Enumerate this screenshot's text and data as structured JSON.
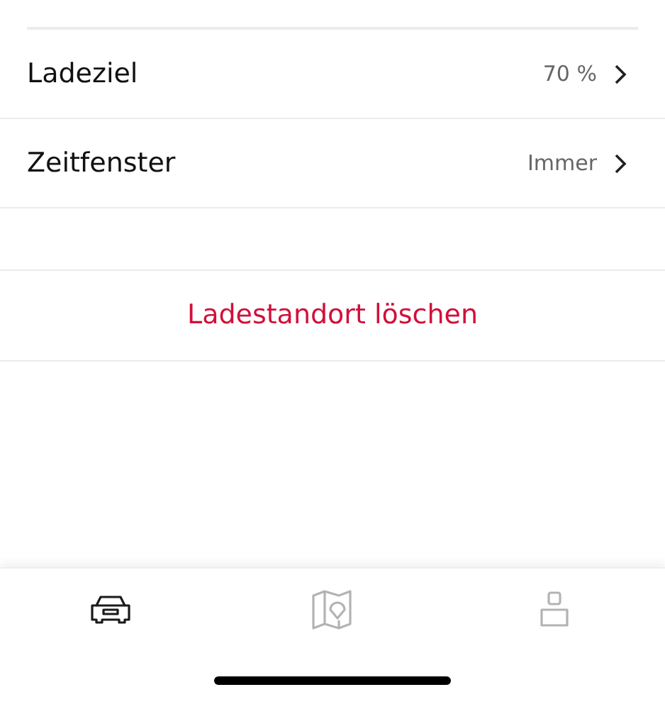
{
  "settings": [
    {
      "label": "Ladeziel",
      "value": "70 %"
    },
    {
      "label": "Zeitfenster",
      "value": "Immer"
    }
  ],
  "delete_button": {
    "label": "Ladestandort löschen"
  },
  "tab_bar": [
    {
      "kind": "car",
      "selected": true
    },
    {
      "kind": "map",
      "selected": false
    },
    {
      "kind": "person",
      "selected": false
    }
  ]
}
